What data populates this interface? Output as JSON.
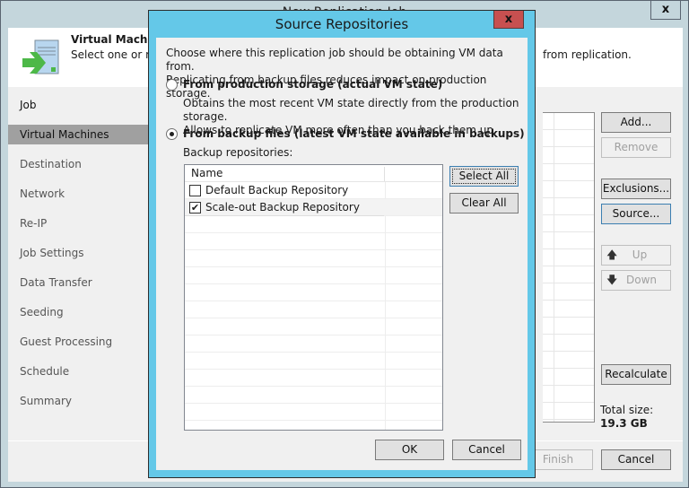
{
  "parent": {
    "title": "New Replication Job",
    "close_icon": "close-icon",
    "header": {
      "title": "Virtual Machines",
      "description_left": "Select one or mo",
      "description_right": "from replication.",
      "icon": "vm-add-icon"
    },
    "nav": {
      "items": [
        {
          "label": "Job",
          "state": "done"
        },
        {
          "label": "Virtual Machines",
          "state": "active"
        },
        {
          "label": "Destination",
          "state": "pending"
        },
        {
          "label": "Network",
          "state": "pending"
        },
        {
          "label": "Re-IP",
          "state": "pending"
        },
        {
          "label": "Job Settings",
          "state": "pending"
        },
        {
          "label": "Data Transfer",
          "state": "pending"
        },
        {
          "label": "Seeding",
          "state": "pending"
        },
        {
          "label": "Guest Processing",
          "state": "pending"
        },
        {
          "label": "Schedule",
          "state": "pending"
        },
        {
          "label": "Summary",
          "state": "pending"
        }
      ]
    },
    "buttons": {
      "add": "Add...",
      "remove": "Remove",
      "exclusions": "Exclusions...",
      "source": "Source...",
      "up": "Up",
      "down": "Down",
      "recalculate": "Recalculate",
      "finish": "Finish",
      "cancel": "Cancel"
    },
    "total_size_label": "Total size:",
    "total_size_value": "19.3 GB"
  },
  "dialog": {
    "title": "Source Repositories",
    "intro_line1": "Choose where this replication job should be obtaining VM data from.",
    "intro_line2": "Replicating from backup files reduces impact on production storage.",
    "option_production": {
      "label": "From production storage (actual VM state)",
      "selected": false,
      "desc_line1": "Obtains the most recent VM state directly from the production storage.",
      "desc_line2": "Allows to replicate VM more often than you back them up."
    },
    "option_backup": {
      "label": "From backup files (latest VM state available in backups)",
      "selected": true
    },
    "repositories_label": "Backup repositories:",
    "list_header": "Name",
    "repositories": [
      {
        "name": "Default Backup Repository",
        "checked": false
      },
      {
        "name": "Scale-out Backup Repository",
        "checked": true
      }
    ],
    "select_all": "Select All",
    "clear_all": "Clear All",
    "ok": "OK",
    "cancel": "Cancel"
  }
}
